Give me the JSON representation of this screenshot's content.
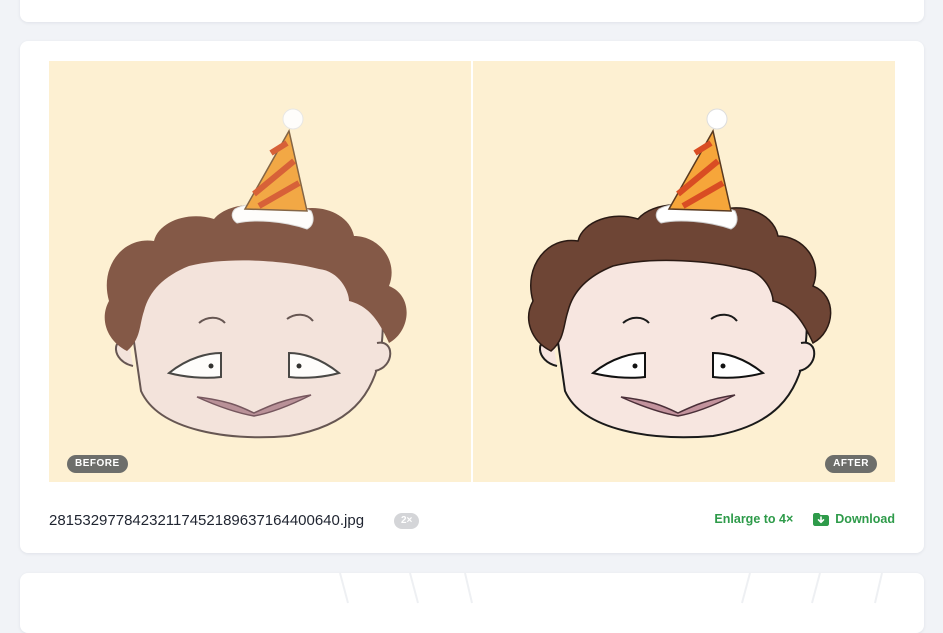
{
  "result": {
    "before_label": "BEFORE",
    "after_label": "AFTER",
    "filename": "28153297784232117452189637164400640.jpg",
    "scale_badge": "2×",
    "enlarge_label": "Enlarge to 4×",
    "download_label": "Download"
  },
  "colors": {
    "accent_green": "#2e9b4a",
    "image_background": "#fdf0d2",
    "badge_background": "#6d6e6b"
  }
}
